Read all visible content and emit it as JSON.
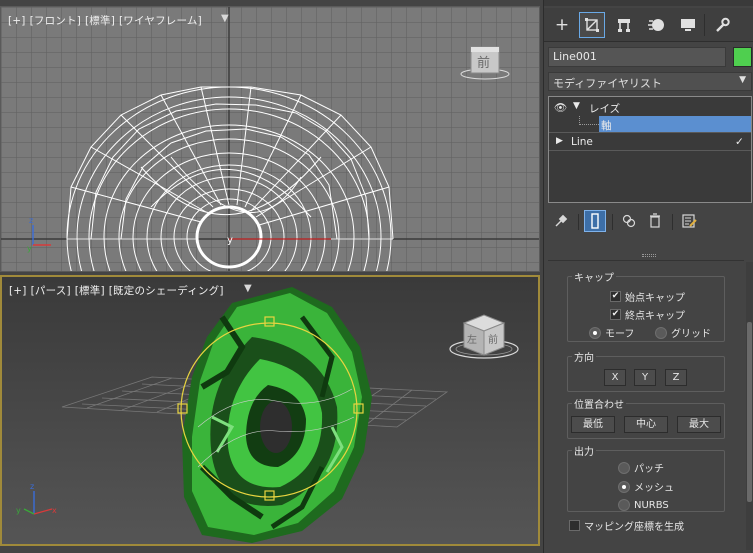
{
  "viewports": {
    "front": {
      "labels": [
        "[+]",
        "[フロント]",
        "[標準]",
        "[ワイヤフレーム]"
      ],
      "filter_icon": "filter-icon",
      "viewcube_face": "前"
    },
    "perspective": {
      "labels": [
        "[+]",
        "[パース]",
        "[標準]",
        "[既定のシェーディング]"
      ],
      "filter_icon": "filter-icon",
      "viewcube_faces": [
        "左",
        "前"
      ]
    }
  },
  "panel": {
    "tabs": [
      "create-icon",
      "modify-icon",
      "hierarchy-icon",
      "motion-icon",
      "display-icon",
      "utilities-icon"
    ],
    "object_name": "Line001",
    "object_color": "#4fcf4f",
    "modifier_list": "モディファイヤリスト",
    "stack": {
      "items": [
        {
          "label": "レイズ",
          "visible": true,
          "expanded": true
        },
        {
          "label": "軸",
          "selected": true
        },
        {
          "label": "Line"
        }
      ]
    },
    "tools": [
      "pin-stack-icon",
      "show-end-result-icon",
      "make-unique-icon",
      "remove-modifier-icon",
      "configure-sets-icon"
    ],
    "cap": {
      "title": "キャップ",
      "start": "始点キャップ",
      "end": "終点キャップ",
      "morph": "モーフ",
      "grid": "グリッド"
    },
    "direction": {
      "title": "方向",
      "buttons": [
        "X",
        "Y",
        "Z"
      ]
    },
    "align": {
      "title": "位置合わせ",
      "buttons": [
        "最低",
        "中心",
        "最大"
      ]
    },
    "output": {
      "title": "出力",
      "patch": "パッチ",
      "mesh": "メッシュ",
      "nurbs": "NURBS"
    },
    "mapping": "マッピング座標を生成"
  }
}
